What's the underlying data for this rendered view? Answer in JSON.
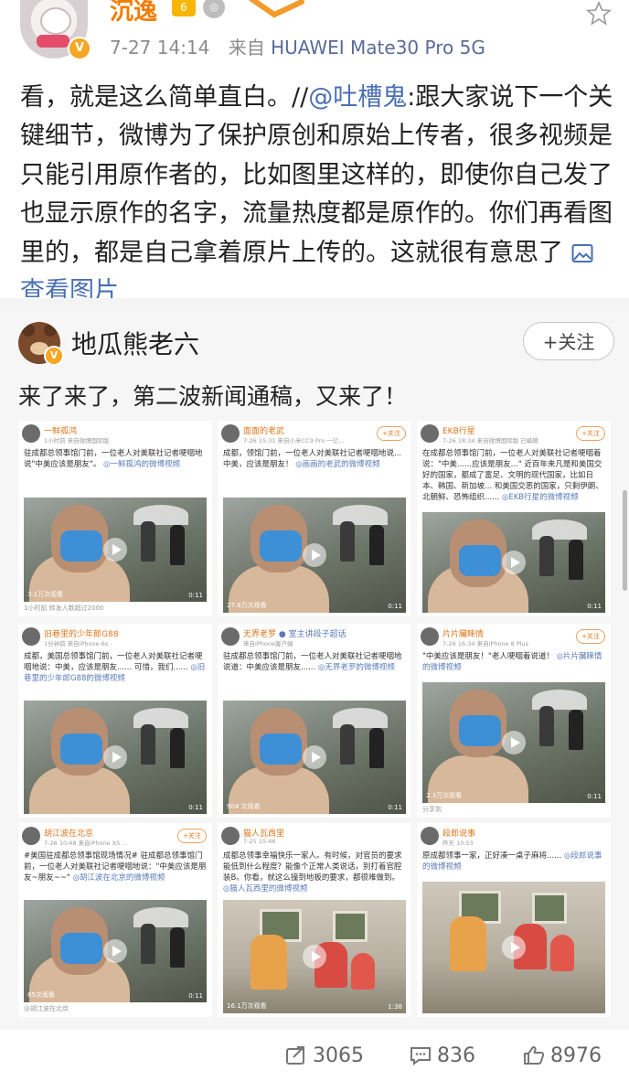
{
  "header": {
    "username": "沉逸",
    "level_badge": "6",
    "time": "7-27 14:14",
    "source_prefix": "来自",
    "source": "HUAWEI Mate30 Pro 5G"
  },
  "post": {
    "text_pre": "看，就是这么简单直白。//",
    "mention": "@吐槽鬼",
    "text_main": ":跟大家说下一个关键细节，微博为了保护原创和原始上传者，很多视频是只能引用原作者的，比如图里这样的，即使你自己发了也显示原作的名字，流量热度都是原作的。你们再看图里的，都是自己拿着原片上传的。这就很有意思了",
    "view_images": "查看图片"
  },
  "repost": {
    "author": "地瓜熊老六",
    "follow_label": "+关注",
    "text": "来了来了，第二波新闻通稿，又来了！"
  },
  "grid": [
    {
      "name": "一鲜孤鸿",
      "sub": "1小时前  来自微博国际版",
      "follow": "",
      "text": "驻成都总领事馆门前，一位老人对美联社记者哽咽地说\"中美应该是朋友\"。",
      "link": "一鲜孤鸿的微博视频",
      "views": "3.1万次观看",
      "dur": "0:11",
      "foot": "1小时前  转发人数超过2000"
    },
    {
      "name": "面面的老武",
      "sub": "7-26 15:31  来自小米CC9 Pro 一亿...",
      "follow": "+关注",
      "text": "成都，领馆门前，一位老人对美联社记者哽咽地说...中美，应该是朋友！",
      "link": "画画的老武的微博视频",
      "views": "27.8万次观看",
      "dur": "0:11",
      "foot": ""
    },
    {
      "name": "EKB行星",
      "sub": "7-26 18:34  来自微博国际版  已编辑",
      "follow": "+关注",
      "text": "在成都总领事馆门前，一位老人对美联社记者哽咽着说：\"中美......应该是朋友...\" 近百年来凡是和美国交好的国家，都成了富足、文明的现代国家，比如日本、韩国、新加坡... 和美国交恶的国家，只剩伊朗、北朝鲜、恐怖组织......",
      "link": "EKB行星的微博视频",
      "views": "",
      "dur": "0:11",
      "foot": ""
    },
    {
      "name": "旧巷里的少年郎G88",
      "sub": "1分钟前  来自iPhone 6s",
      "follow": "",
      "text": "成都，美国总领事馆门前，一位老人对美联社记者哽咽地说：中美，应该是朋友...... 可惜，我们......",
      "link": "旧巷里的少年郎G88的微博视频",
      "views": "",
      "dur": "0:11",
      "foot": ""
    },
    {
      "name": "无界老罗",
      "sub": "来自iPhone客户端",
      "follow": "",
      "tag": "● 室主讲段子超话",
      "text": "驻成都总领事馆门前，一位老人对美联社记者哽咽地说道：中美应该是朋友......",
      "link": "无界老罗的微博视频",
      "views": "904 次观看",
      "dur": "0:11",
      "foot": ""
    },
    {
      "name": "片片臟睐情",
      "sub": "7-26 16:34  来自iPhone 8 Plus",
      "follow": "+关注",
      "text": "\"中美应该是朋友！\"老人哽咽着说道！",
      "link": "片片臟睐情的微博视频",
      "views": "2.3万次观看",
      "dur": "0:11",
      "foot": "分享到"
    },
    {
      "name": "胡江波在北京",
      "sub": "7-26 10:48  来自iPhone XS ...",
      "follow": "+关注",
      "text": "#美国驻成都总领事馆现场情况# 驻成都总领事馆门前，一位老人对美联社记者哽咽地说：\"中美应该是朋友~朋友~~\"",
      "link": "胡江波在北京的微博视频",
      "views": "85次观看",
      "dur": "0:11",
      "foot": "@胡江波在北京"
    },
    {
      "name": "猫人瓦西里",
      "sub": "7-25 15:46",
      "follow": "",
      "text": "成都总领事幸福快乐一家人。有时候，对官员的要求能低到什么程度？能像个正常人类说话，别打着官腔装B。你看，就这么撞到地板的要求，都很难做到。",
      "link": "猫人瓦西里的微博视频",
      "views": "16.1万次观看",
      "dur": "1:38",
      "foot": ""
    },
    {
      "name": "段郎说事",
      "sub": "昨天 10:53",
      "follow": "",
      "text": "原成都领事一家，正好凑一桌子麻将......",
      "link": "段郎说事的微博视频",
      "views": "",
      "dur": "",
      "foot": ""
    }
  ],
  "actions": {
    "repost_count": "3065",
    "comment_count": "836",
    "like_count": "8976"
  }
}
